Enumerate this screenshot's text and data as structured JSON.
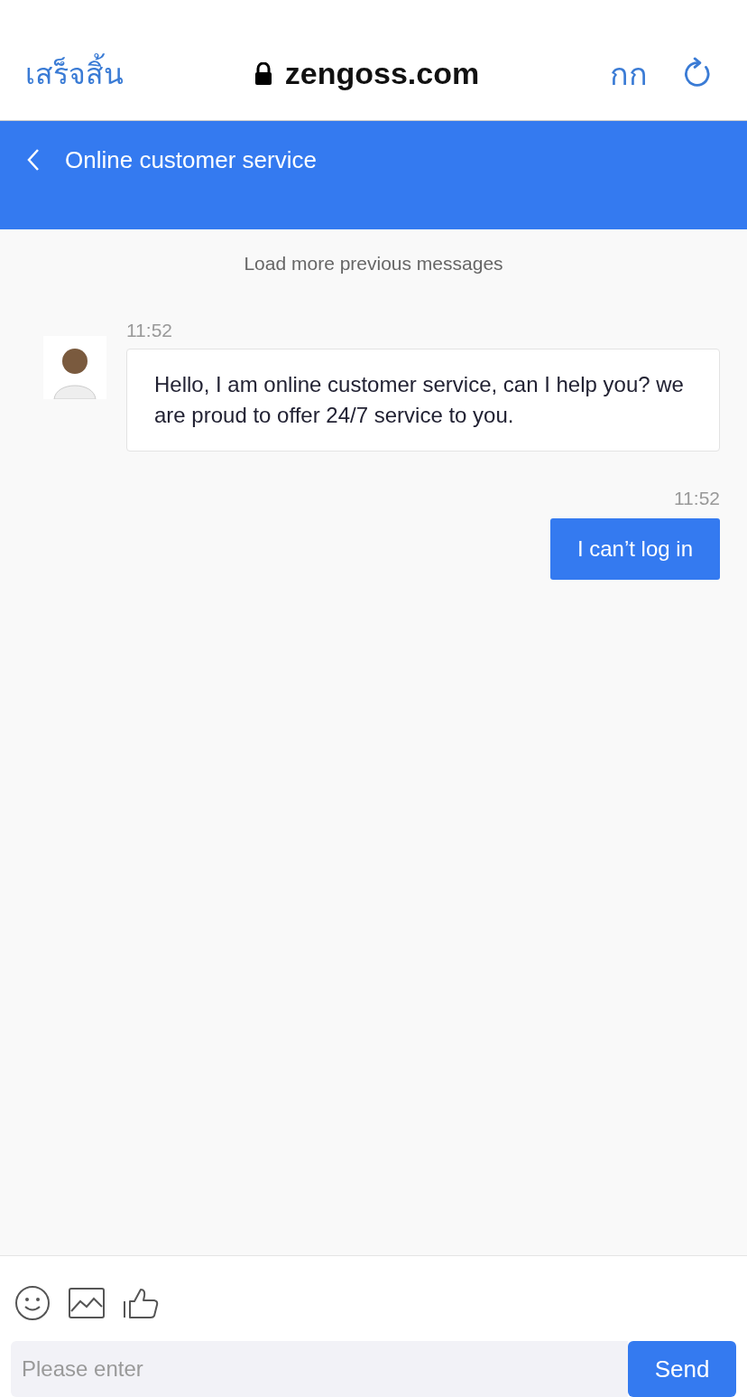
{
  "browser_bar": {
    "done_label": "เสร็จสิ้น",
    "url": "zengoss.com",
    "text_size_label": "กก"
  },
  "header": {
    "title": "Online customer service"
  },
  "load_more": "Load more previous messages",
  "messages": [
    {
      "kind": "agent",
      "time": "11:52",
      "text": "Hello, I am online customer service, can I help you? we are proud to offer 24/7 service to you."
    },
    {
      "kind": "user",
      "time": "11:52",
      "text": "I can’t log in"
    }
  ],
  "composer": {
    "placeholder": "Please enter",
    "send_label": "Send"
  }
}
